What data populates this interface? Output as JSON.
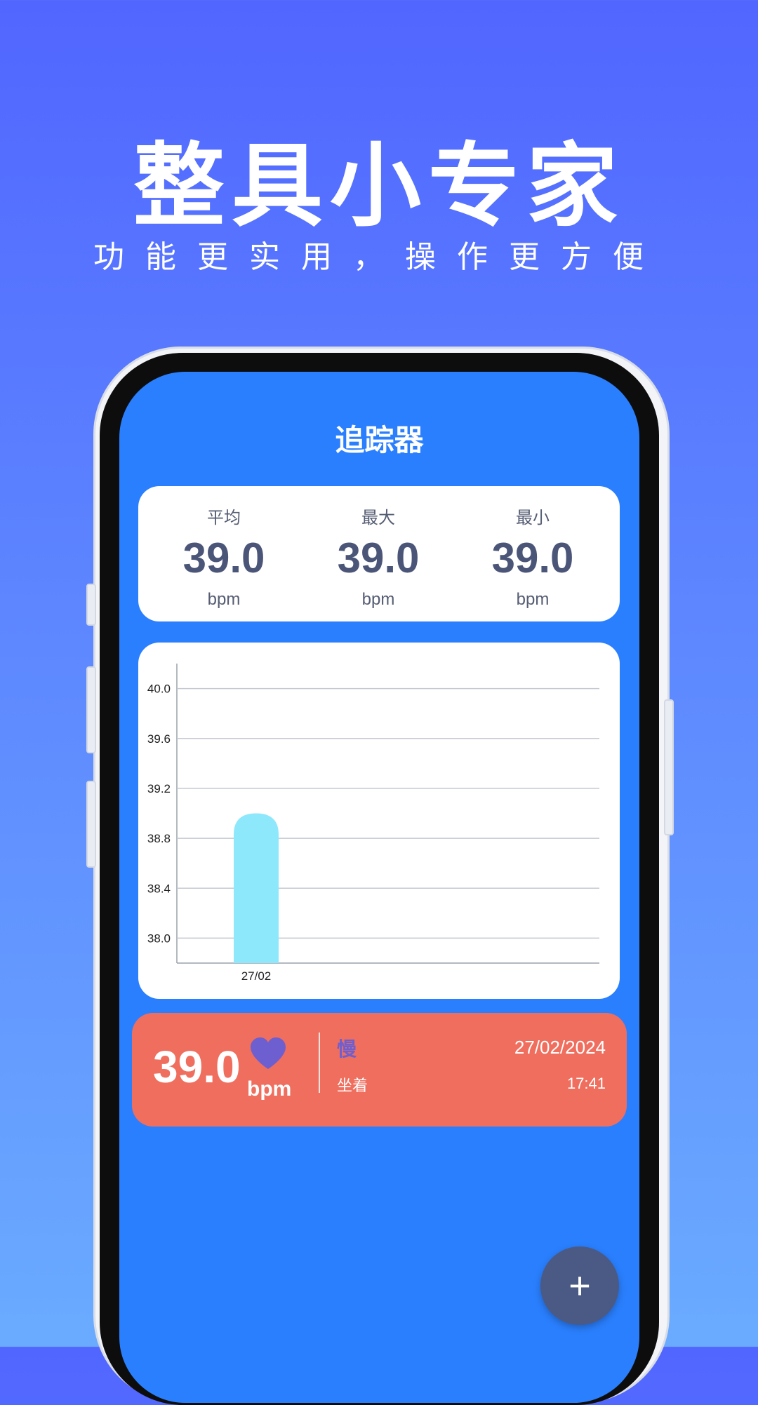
{
  "promo": {
    "title": "整具小专家",
    "subtitle": "功能更实用，操作更方便"
  },
  "screen": {
    "title": "追踪器",
    "stats": [
      {
        "label": "平均",
        "value": "39.0",
        "unit": "bpm"
      },
      {
        "label": "最大",
        "value": "39.0",
        "unit": "bpm"
      },
      {
        "label": "最小",
        "value": "39.0",
        "unit": "bpm"
      }
    ],
    "record": {
      "value": "39.0",
      "unit": "bpm",
      "status": "慢",
      "posture": "坐着",
      "date": "27/02/2024",
      "time": "17:41"
    },
    "fab_label": "+",
    "colors": {
      "background": "#2a7ffe",
      "record_card": "#ef6e5e",
      "bar": "#8ee8fc",
      "heart": "#6e5fd0",
      "fab": "#4b5a84"
    }
  },
  "chart_data": {
    "type": "bar",
    "categories": [
      "27/02"
    ],
    "values": [
      39.0
    ],
    "ylim": [
      37.8,
      40.2
    ],
    "yticks": [
      "40.0",
      "39.6",
      "39.2",
      "38.8",
      "38.4",
      "38.0"
    ],
    "grid": true
  }
}
